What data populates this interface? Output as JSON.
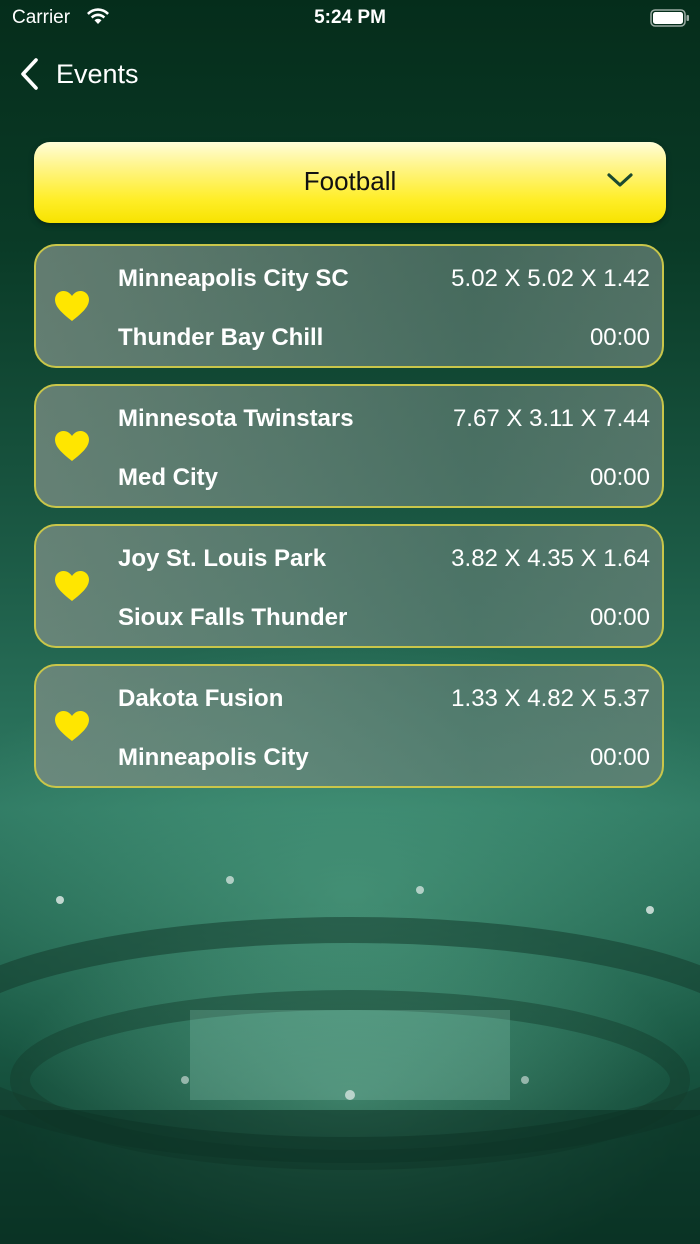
{
  "status_bar": {
    "carrier": "Carrier",
    "time": "5:24 PM"
  },
  "nav": {
    "back_label": "Events"
  },
  "sport_selector": {
    "selected": "Football"
  },
  "events": [
    {
      "team1": "Minneapolis City SC",
      "team2": "Thunder Bay Chill",
      "odds": "5.02 X 5.02 X 1.42",
      "time": "00:00"
    },
    {
      "team1": "Minnesota Twinstars",
      "team2": "Med City",
      "odds": "7.67 X 3.11 X 7.44",
      "time": "00:00"
    },
    {
      "team1": "Joy St. Louis Park",
      "team2": "Sioux Falls Thunder",
      "odds": "3.82 X 4.35 X 1.64",
      "time": "00:00"
    },
    {
      "team1": "Dakota Fusion",
      "team2": "Minneapolis City",
      "odds": "1.33 X 4.82 X 5.37",
      "time": "00:00"
    }
  ],
  "colors": {
    "accent_yellow": "#ffee2a",
    "heart": "#ffe600",
    "card_border": "#c9c64a"
  },
  "icons": {
    "back": "chevron-left-icon",
    "dropdown": "chevron-down-icon",
    "favorite": "heart-icon"
  }
}
